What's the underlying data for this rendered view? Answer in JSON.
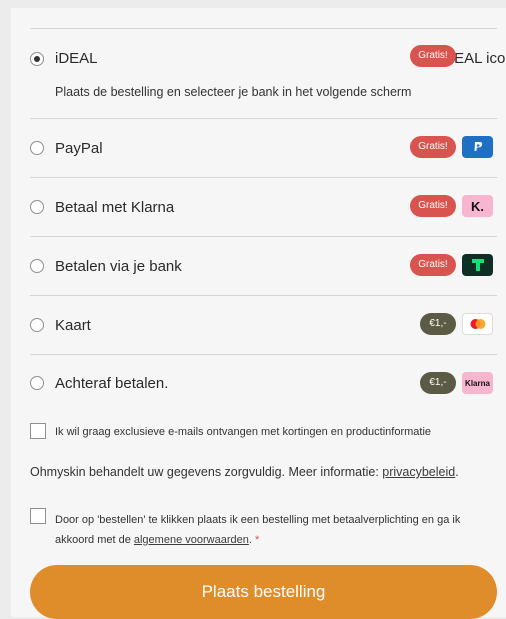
{
  "payment_methods": [
    {
      "label": "iDEAL",
      "selected": true,
      "description": "Plaats de bestelling en selecteer je bank in het volgende scherm",
      "badge": "Gratis!",
      "badge_color": "#d9534f",
      "logo_alt": "iDEAL icon"
    },
    {
      "label": "PayPal",
      "selected": false,
      "badge": "Gratis!",
      "badge_color": "#d9534f",
      "logo": "paypal-logo-icon"
    },
    {
      "label": "Betaal met Klarna",
      "selected": false,
      "badge": "Gratis!",
      "badge_color": "#d9534f",
      "logo": "klarna-k-logo-icon",
      "logo_text": "K."
    },
    {
      "label": "Betalen via je bank",
      "selected": false,
      "badge": "Gratis!",
      "badge_color": "#d9534f",
      "logo": "trustly-logo-icon"
    },
    {
      "label": "Kaart",
      "selected": false,
      "badge": "€1,-",
      "badge_color": "#5b5b45",
      "logo": "mastercard-logo-icon"
    },
    {
      "label": "Achteraf betalen.",
      "selected": false,
      "badge": "€1,-",
      "badge_color": "#5b5b45",
      "logo": "klarna-wordmark-logo-icon",
      "logo_text": "Klarna"
    }
  ],
  "newsletter": {
    "label": "Ik wil graag exclusieve e-mails ontvangen met kortingen en productinformatie",
    "checked": false
  },
  "privacy": {
    "text": "Ohmyskin behandelt uw gegevens zorgvuldig. Meer informatie: ",
    "link": "privacybeleid",
    "suffix": "."
  },
  "terms": {
    "text": "Door op 'bestellen' te klikken plaats ik een bestelling met betaalverplichting en ga ik akkoord met de ",
    "link": "algemene voorwaarden",
    "suffix": ".",
    "required_marker": "*",
    "checked": false
  },
  "submit_label": "Plaats bestelling",
  "colors": {
    "accent": "#df8d2a",
    "free_badge": "#d9534f",
    "fee_badge": "#5b5b45"
  }
}
